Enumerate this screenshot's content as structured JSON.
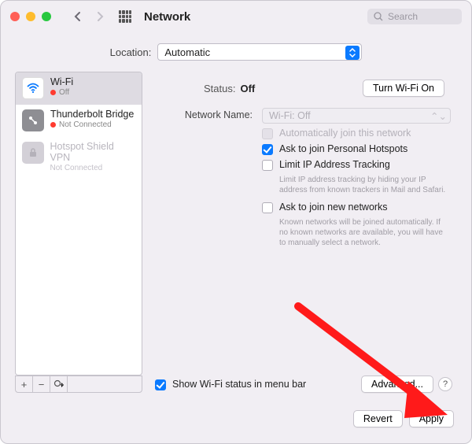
{
  "window": {
    "title": "Network"
  },
  "search": {
    "placeholder": "Search"
  },
  "location": {
    "label": "Location:",
    "value": "Automatic",
    "icon": "chevrons"
  },
  "sidebar": {
    "items": [
      {
        "name": "Wi-Fi",
        "status_dot": "red",
        "status": "Off",
        "icon": "wifi",
        "selected": true
      },
      {
        "name": "Thunderbolt Bridge",
        "status_dot": "red",
        "status": "Not Connected",
        "icon": "bridge",
        "selected": false
      },
      {
        "name": "Hotspot Shield VPN",
        "status_dot": "",
        "status": "Not Connected",
        "icon": "lock",
        "disabled": true
      }
    ]
  },
  "detail": {
    "status_label": "Status:",
    "status_value": "Off",
    "toggle_button": "Turn Wi-Fi On",
    "network_name_label": "Network Name:",
    "network_name_value": "Wi-Fi: Off",
    "checkboxes": {
      "auto_join": {
        "label": "Automatically join this network",
        "checked": false,
        "disabled": true
      },
      "personal_hotspots": {
        "label": "Ask to join Personal Hotspots",
        "checked": true
      },
      "limit_ip": {
        "label": "Limit IP Address Tracking",
        "checked": false,
        "help": "Limit IP address tracking by hiding your IP address from known trackers in Mail and Safari."
      },
      "ask_new": {
        "label": "Ask to join new networks",
        "checked": false,
        "help": "Known networks will be joined automatically. If no known networks are available, you will have to manually select a network."
      }
    },
    "show_menu_bar": {
      "label": "Show Wi-Fi status in menu bar",
      "checked": true
    },
    "advanced_button": "Advanced...",
    "help_button": "?"
  },
  "footer": {
    "revert": "Revert",
    "apply": "Apply"
  }
}
